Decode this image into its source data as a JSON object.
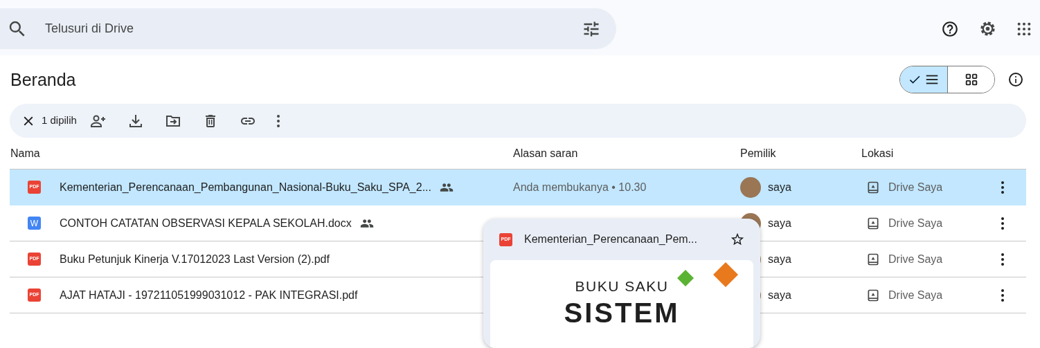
{
  "search": {
    "placeholder": "Telusuri di Drive"
  },
  "page_title": "Beranda",
  "view_toggle": [
    {
      "kind": "list",
      "selected": true
    },
    {
      "kind": "grid",
      "selected": false
    }
  ],
  "selection_bar": {
    "count": "1 dipilih"
  },
  "columns": [
    "Nama",
    "Alasan saran",
    "Pemilik",
    "Lokasi"
  ],
  "files": [
    {
      "kind": "pdf",
      "badge": "PDF",
      "name": "Kementerian_Perencanaan_Pembangunan_Nasional-Buku_Saku_SPA_2...",
      "shared": true,
      "selected": true,
      "reason": "Anda membukanya • 10.30",
      "owner": "saya",
      "location": "Drive Saya"
    },
    {
      "kind": "word",
      "badge": "W",
      "name": "CONTOH CATATAN OBSERVASI KEPALA SEKOLAH.docx",
      "shared": true,
      "selected": false,
      "owner": "saya",
      "location": "Drive Saya"
    },
    {
      "kind": "pdf",
      "badge": "PDF",
      "name": "Buku Petunjuk Kinerja V.17012023 Last Version (2).pdf",
      "shared": false,
      "selected": false,
      "owner": "saya",
      "location": "Drive Saya"
    },
    {
      "kind": "pdf",
      "badge": "PDF",
      "name": "AJAT HATAJI - 197211051999031012 - PAK INTEGRASI.pdf",
      "shared": false,
      "selected": false,
      "owner": "saya",
      "location": "Drive Saya"
    }
  ],
  "preview_card": {
    "badge": "PDF",
    "title": "Kementerian_Perencanaan_Pem...",
    "starred": false,
    "page_lines": [
      "BUKU SAKU",
      "SISTEM"
    ]
  }
}
